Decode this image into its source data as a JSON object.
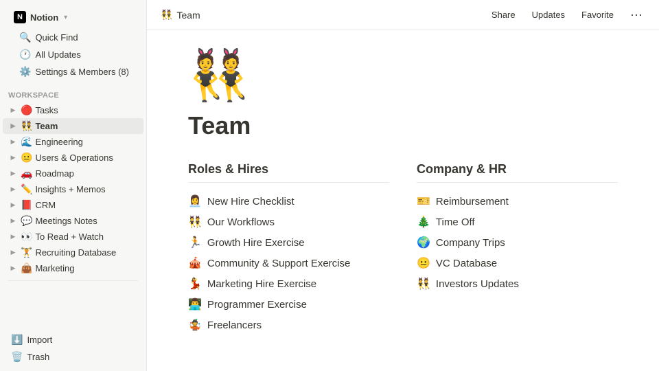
{
  "app": {
    "name": "Notion",
    "workspace": "Notion",
    "chevron": "▾"
  },
  "topbar": {
    "emoji": "👯",
    "title": "Team",
    "actions": [
      "Share",
      "Updates",
      "Favorite",
      "···"
    ]
  },
  "sidebar": {
    "top_items": [
      {
        "icon": "🔍",
        "label": "Quick Find"
      },
      {
        "icon": "🕐",
        "label": "All Updates"
      },
      {
        "icon": "⚙️",
        "label": "Settings & Members (8)"
      }
    ],
    "workspace_label": "WORKSPACE",
    "workspace_items": [
      {
        "emoji": "🔴",
        "label": "Tasks",
        "active": false
      },
      {
        "emoji": "👯",
        "label": "Team",
        "active": true
      },
      {
        "emoji": "🌊",
        "label": "Engineering",
        "active": false
      },
      {
        "emoji": "😐",
        "label": "Users & Operations",
        "active": false
      },
      {
        "emoji": "🚗",
        "label": "Roadmap",
        "active": false
      },
      {
        "emoji": "✏️",
        "label": "Insights + Memos",
        "active": false
      },
      {
        "emoji": "📕",
        "label": "CRM",
        "active": false
      },
      {
        "emoji": "💬",
        "label": "Meetings Notes",
        "active": false
      },
      {
        "emoji": "👀",
        "label": "To Read + Watch",
        "active": false
      },
      {
        "emoji": "🏋️",
        "label": "Recruiting Database",
        "active": false
      },
      {
        "emoji": "👜",
        "label": "Marketing",
        "active": false
      }
    ],
    "bottom_items": [
      {
        "icon": "⬇️",
        "label": "Import"
      },
      {
        "icon": "🗑️",
        "label": "Trash"
      }
    ]
  },
  "page": {
    "emoji": "👯",
    "title": "Team",
    "sections": [
      {
        "heading": "Roles & Hires",
        "items": [
          {
            "emoji": "👩‍💼",
            "label": "New Hire Checklist"
          },
          {
            "emoji": "👯",
            "label": "Our Workflows"
          },
          {
            "emoji": "🏃",
            "label": "Growth Hire Exercise"
          },
          {
            "emoji": "🎪",
            "label": "Community & Support Exercise"
          },
          {
            "emoji": "💃",
            "label": "Marketing Hire Exercise"
          },
          {
            "emoji": "👨‍💻",
            "label": "Programmer Exercise"
          },
          {
            "emoji": "🤹",
            "label": "Freelancers"
          }
        ]
      },
      {
        "heading": "Company & HR",
        "items": [
          {
            "emoji": "🎫",
            "label": "Reimbursement"
          },
          {
            "emoji": "🎄",
            "label": "Time Off"
          },
          {
            "emoji": "🌍",
            "label": "Company Trips"
          },
          {
            "emoji": "😐",
            "label": "VC Database"
          },
          {
            "emoji": "👯",
            "label": "Investors Updates"
          }
        ]
      }
    ]
  }
}
